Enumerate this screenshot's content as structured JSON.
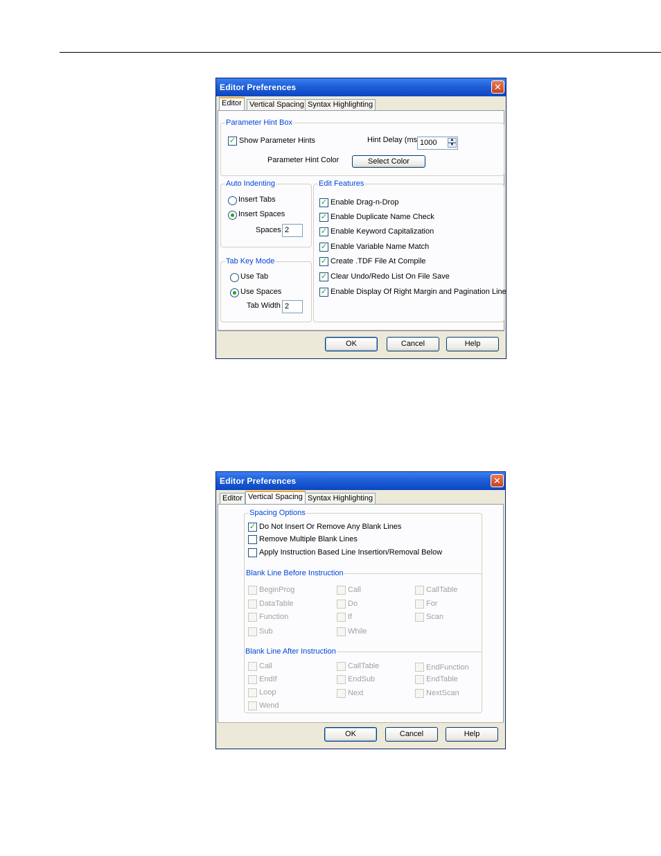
{
  "dialog1": {
    "title": "Editor Preferences",
    "close_glyph": "✕",
    "tabs": [
      "Editor",
      "Vertical Spacing",
      "Syntax Highlighting"
    ],
    "param_hint": {
      "legend": "Parameter Hint Box",
      "show_label": "Show Parameter Hints",
      "show_checked": true,
      "delay_label": "Hint Delay (ms)",
      "delay_value": "1000",
      "color_label": "Parameter Hint Color",
      "color_button": "Select Color"
    },
    "auto_indent": {
      "legend": "Auto Indenting",
      "opt_tabs": "Insert Tabs",
      "opt_spaces": "Insert Spaces",
      "selected": "Insert Spaces",
      "spaces_label": "Spaces",
      "spaces_value": "2"
    },
    "tab_key": {
      "legend": "Tab Key  Mode",
      "opt_tab": "Use Tab",
      "opt_spaces": "Use Spaces",
      "selected": "Use Spaces",
      "width_label": "Tab Width",
      "width_value": "2"
    },
    "edit_features": {
      "legend": "Edit Features",
      "items": [
        "Enable Drag-n-Drop",
        "Enable Duplicate Name Check",
        "Enable Keyword Capitalization",
        "Enable Variable Name Match",
        "Create .TDF File At Compile",
        "Clear Undo/Redo List On File Save",
        "Enable Display Of Right Margin and Pagination Lines"
      ]
    },
    "buttons": {
      "ok": "OK",
      "cancel": "Cancel",
      "help": "Help"
    }
  },
  "dialog2": {
    "title": "Editor Preferences",
    "close_glyph": "✕",
    "tabs": [
      "Editor",
      "Vertical Spacing",
      "Syntax Highlighting"
    ],
    "spacing_options": {
      "legend": "Spacing Options",
      "items": [
        {
          "label": "Do Not Insert Or Remove Any Blank Lines",
          "checked": true
        },
        {
          "label": "Remove Multiple Blank Lines",
          "checked": false
        },
        {
          "label": "Apply Instruction Based Line Insertion/Removal Below",
          "checked": false
        }
      ]
    },
    "before": {
      "legend": "Blank Line Before Instruction",
      "items": [
        "BeginProg",
        "Call",
        "CallTable",
        "DataTable",
        "Do",
        "For",
        "Function",
        "If",
        "Scan",
        "Sub",
        "While"
      ]
    },
    "after": {
      "legend": "Blank Line After Instruction",
      "items": [
        "Call",
        "CallTable",
        "EndFunction",
        "EndIf",
        "EndSub",
        "EndTable",
        "Loop",
        "Next",
        "NextScan",
        "Wend"
      ]
    },
    "buttons": {
      "ok": "OK",
      "cancel": "Cancel",
      "help": "Help"
    }
  }
}
